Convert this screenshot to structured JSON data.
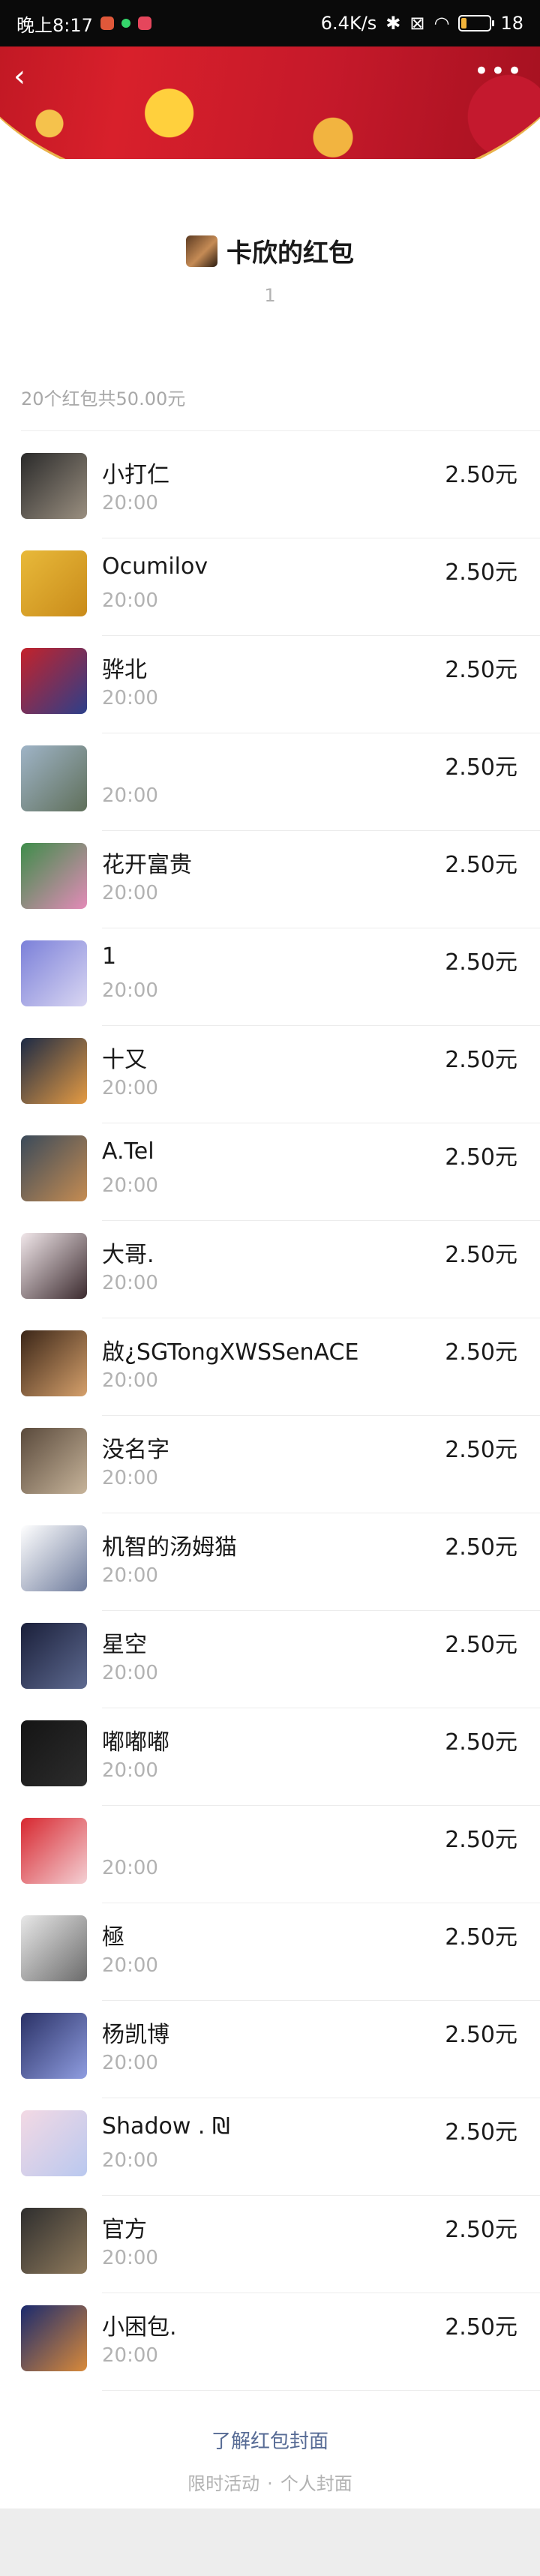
{
  "status_bar": {
    "time": "晚上8:17",
    "network_speed": "6.4K/s",
    "battery": "18",
    "battery_fraction": 0.18
  },
  "header": {
    "back_icon": "back-chevron-icon",
    "more_icon": "more-dots-icon"
  },
  "sender": {
    "title": "卡欣的红包",
    "subtitle": "1"
  },
  "summary": "20个红包共50.00元",
  "recipients": [
    {
      "name": "小打仁",
      "time": "20:00",
      "amount": "2.50元",
      "colors": [
        "#2a2a2a",
        "#9a8f80"
      ]
    },
    {
      "name": "Ocumilov",
      "time": "20:00",
      "amount": "2.50元",
      "colors": [
        "#e8b93a",
        "#c98b1a"
      ]
    },
    {
      "name": "骅北",
      "time": "20:00",
      "amount": "2.50元",
      "colors": [
        "#c4222a",
        "#2c3f8a"
      ]
    },
    {
      "name": "",
      "time": "20:00",
      "amount": "2.50元",
      "colors": [
        "#9fb4c7",
        "#5f6f5a"
      ]
    },
    {
      "name": "花开富贵",
      "time": "20:00",
      "amount": "2.50元",
      "colors": [
        "#3e8d4a",
        "#e38bb8"
      ]
    },
    {
      "name": "1",
      "time": "20:00",
      "amount": "2.50元",
      "colors": [
        "#7b80d9",
        "#d9d6f2"
      ]
    },
    {
      "name": "十又",
      "time": "20:00",
      "amount": "2.50元",
      "colors": [
        "#1c2a45",
        "#e59b43"
      ]
    },
    {
      "name": "A.Tel",
      "time": "20:00",
      "amount": "2.50元",
      "colors": [
        "#3a4a5a",
        "#c58c52"
      ]
    },
    {
      "name": "大哥.",
      "time": "20:00",
      "amount": "2.50元",
      "colors": [
        "#f1e7ea",
        "#3b2a2e"
      ]
    },
    {
      "name": "啟¿SGTongXWSSenACE",
      "time": "20:00",
      "amount": "2.50元",
      "colors": [
        "#3b2618",
        "#d5a06b"
      ]
    },
    {
      "name": "没名字",
      "time": "20:00",
      "amount": "2.50元",
      "colors": [
        "#5a4a3c",
        "#c7b49a"
      ]
    },
    {
      "name": "机智的汤姆猫",
      "time": "20:00",
      "amount": "2.50元",
      "colors": [
        "#ffffff",
        "#6e7b9c"
      ]
    },
    {
      "name": "星空",
      "time": "20:00",
      "amount": "2.50元",
      "colors": [
        "#1a1f3a",
        "#5e6a90"
      ]
    },
    {
      "name": "嘟嘟嘟",
      "time": "20:00",
      "amount": "2.50元",
      "colors": [
        "#141414",
        "#2d2d2d"
      ]
    },
    {
      "name": "",
      "time": "20:00",
      "amount": "2.50元",
      "colors": [
        "#d7272f",
        "#f4d0d4"
      ]
    },
    {
      "name": "極",
      "time": "20:00",
      "amount": "2.50元",
      "colors": [
        "#e8e8e8",
        "#6b6b6b"
      ]
    },
    {
      "name": "杨凯博",
      "time": "20:00",
      "amount": "2.50元",
      "colors": [
        "#2a3166",
        "#8f9de0"
      ]
    },
    {
      "name": "Shadow . ₪",
      "time": "20:00",
      "amount": "2.50元",
      "colors": [
        "#f3d9e4",
        "#b9c8ef"
      ]
    },
    {
      "name": "官方",
      "time": "20:00",
      "amount": "2.50元",
      "colors": [
        "#2e2e2e",
        "#8f7a5c"
      ]
    },
    {
      "name": "小困包.",
      "time": "20:00",
      "amount": "2.50元",
      "colors": [
        "#1a2a6e",
        "#d98a3a"
      ]
    }
  ],
  "footer": {
    "learn_link": "了解红包封面",
    "note_left": "限时活动",
    "note_sep": "·",
    "note_right": "个人封面"
  },
  "colors": {
    "link": "#576b95",
    "muted": "#b2b2b2",
    "cover_red": "#c5192a",
    "cover_gold": "#e9b24b"
  }
}
